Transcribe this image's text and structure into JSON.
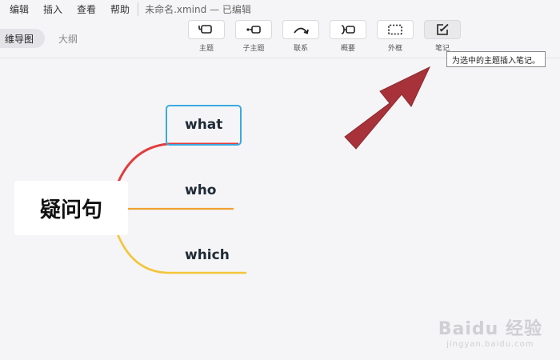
{
  "menu": {
    "items": [
      "编辑",
      "插入",
      "查看",
      "帮助"
    ],
    "document_title": "未命名.xmind — 已编辑"
  },
  "view_tabs": {
    "active": "维导图",
    "other": "大纲"
  },
  "toolbar": {
    "tools": [
      {
        "label": "主题",
        "icon": "topic-icon"
      },
      {
        "label": "子主题",
        "icon": "subtopic-icon"
      },
      {
        "label": "联系",
        "icon": "relationship-icon"
      },
      {
        "label": "概要",
        "icon": "summary-icon"
      },
      {
        "label": "外框",
        "icon": "boundary-icon"
      },
      {
        "label": "笔记",
        "icon": "note-icon"
      }
    ],
    "active_tool": "笔记",
    "tooltip": "为选中的主题插入笔记。"
  },
  "mindmap": {
    "central_topic": "疑问句",
    "subtopics": [
      {
        "label": "what",
        "color": "#e23d3d",
        "selected": true
      },
      {
        "label": "who",
        "color": "#f0a030",
        "selected": false
      },
      {
        "label": "which",
        "color": "#f3c53a",
        "selected": false
      }
    ]
  },
  "annotation": {
    "arrow_color": "#a8323a",
    "arrow_target": "note-icon"
  },
  "colors": {
    "selection": "#3aa9e0",
    "background": "#f5f5f7"
  },
  "watermark": {
    "main": "Baidu 经验",
    "sub": "jingyan.baidu.com"
  }
}
